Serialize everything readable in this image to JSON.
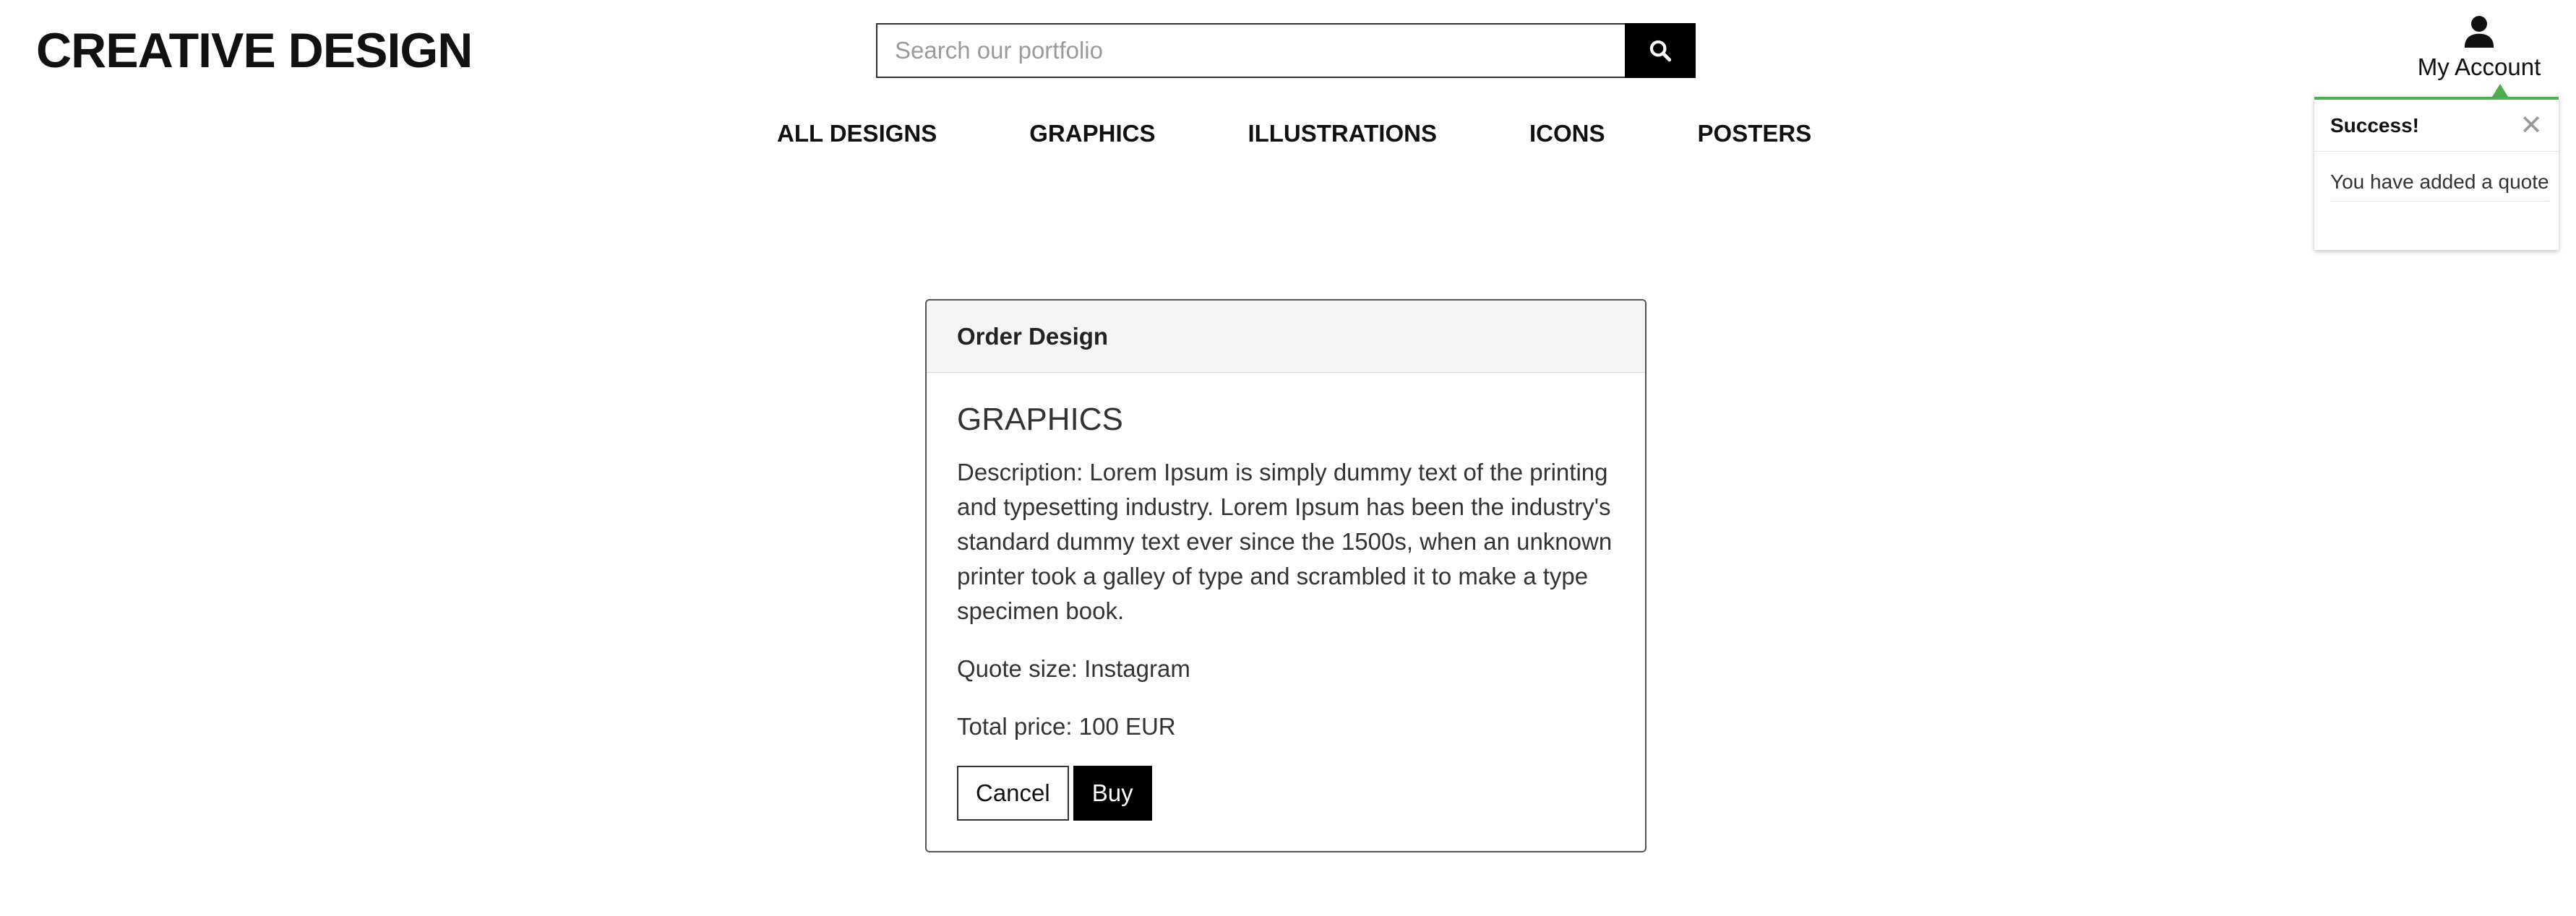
{
  "header": {
    "logo": "CREATIVE DESIGN",
    "search": {
      "placeholder": "Search our portfolio",
      "value": ""
    },
    "search_icon": "search-icon",
    "account": {
      "label": "My Account",
      "icon": "user-icon"
    }
  },
  "nav": {
    "items": [
      {
        "label": "ALL DESIGNS"
      },
      {
        "label": "GRAPHICS"
      },
      {
        "label": "ILLUSTRATIONS"
      },
      {
        "label": "ICONS"
      },
      {
        "label": "POSTERS"
      }
    ]
  },
  "toast": {
    "title": "Success!",
    "message": "You have added a quote",
    "close_icon": "close-icon",
    "accent_color": "#4caf50"
  },
  "order": {
    "header_title": "Order Design",
    "design_name": "GRAPHICS",
    "description": "Description: Lorem Ipsum is simply dummy text of the printing and typesetting industry. Lorem Ipsum has been the industry's standard dummy text ever since the 1500s, when an unknown printer took a galley of type and scrambled it to make a type specimen book.",
    "quote_size": "Quote size: Instagram",
    "total_price": "Total price: 100 EUR",
    "cancel_label": "Cancel",
    "buy_label": "Buy"
  }
}
